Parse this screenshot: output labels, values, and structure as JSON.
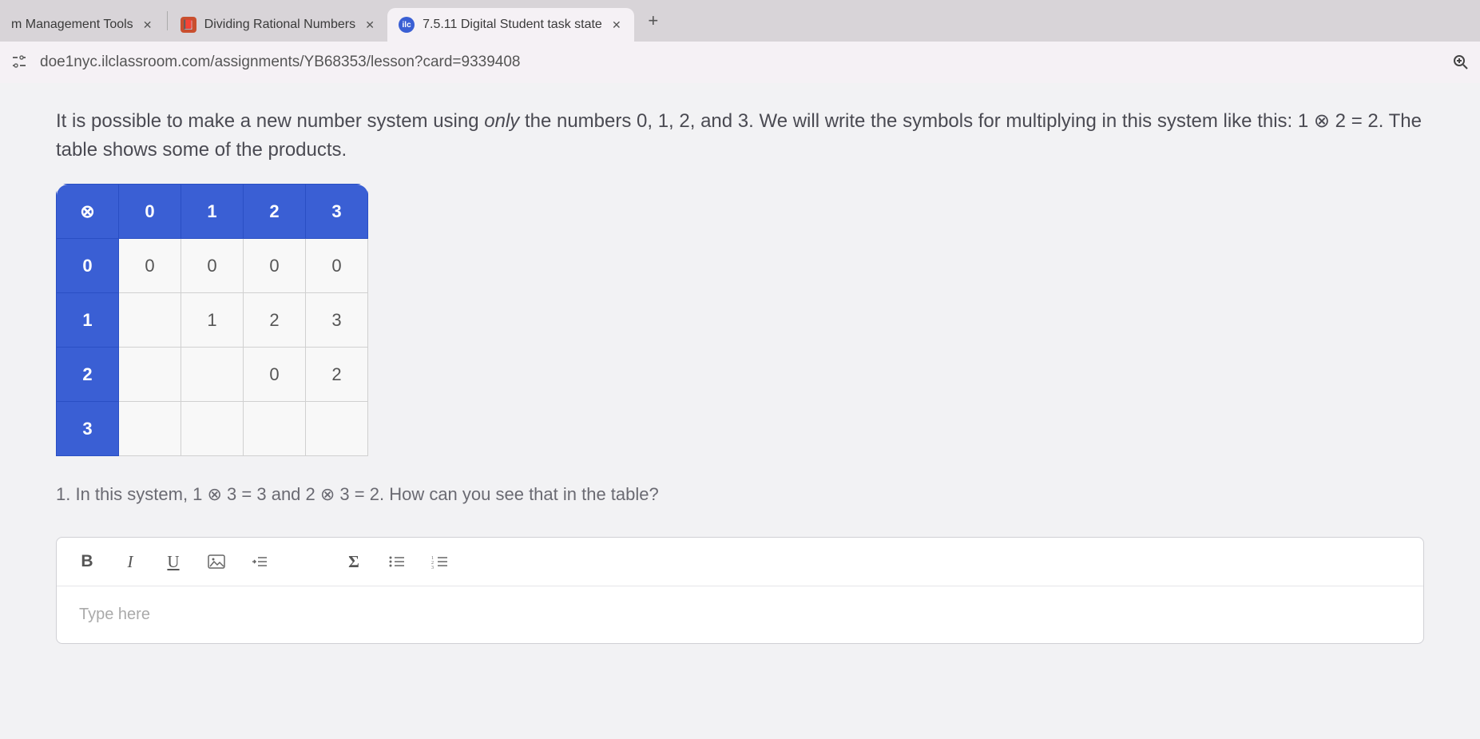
{
  "tabs": [
    {
      "title": "m Management Tools",
      "active": false,
      "favicon_bg": "#fff",
      "favicon_fg": "#888"
    },
    {
      "title": "Dividing Rational Numbers",
      "active": false,
      "favicon_bg": "#c94f2f",
      "favicon_fg": "#fff"
    },
    {
      "title": "7.5.11 Digital Student task state",
      "active": true,
      "favicon_bg": "#3a5fd4",
      "favicon_fg": "#fff",
      "favicon_text": "ilc"
    }
  ],
  "url": "doe1nyc.ilclassroom.com/assignments/YB68353/lesson?card=9339408",
  "intro_prefix": "It is possible to make a new number system using ",
  "intro_only": "only",
  "intro_suffix": " the numbers 0, 1, 2, and 3. We will write the symbols for multiplying in this system like this: 1 ⊗ 2 = 2. The table shows some of the products.",
  "table": {
    "corner": "⊗",
    "col_headers": [
      "0",
      "1",
      "2",
      "3"
    ],
    "row_headers": [
      "0",
      "1",
      "2",
      "3"
    ],
    "cells": [
      [
        "0",
        "0",
        "0",
        "0"
      ],
      [
        "",
        "1",
        "2",
        "3"
      ],
      [
        "",
        "",
        "0",
        "2"
      ],
      [
        "",
        "",
        "",
        ""
      ]
    ]
  },
  "question": "1. In this system, 1 ⊗ 3 = 3 and 2 ⊗ 3 = 2. How can you see that in the table?",
  "toolbar": {
    "bold": "B",
    "italic": "I",
    "underline": "U",
    "image": "🖼",
    "indent": "⇥≡",
    "sigma": "Σ",
    "bullet": "•≡",
    "numbered": "1≡"
  },
  "editor_placeholder": "Type here"
}
